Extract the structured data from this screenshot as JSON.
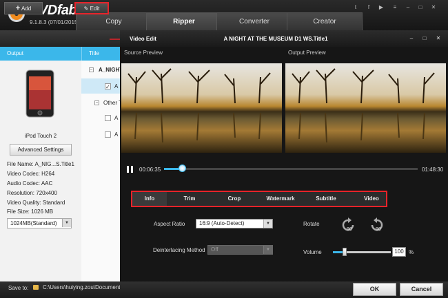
{
  "app": {
    "brand": "DVDfab",
    "version": "9.1.8.3 (07/01/2015)"
  },
  "tabs": [
    {
      "label": "Copy"
    },
    {
      "label": "Ripper"
    },
    {
      "label": "Converter"
    },
    {
      "label": "Creator"
    }
  ],
  "toolbar": {
    "add_label": "Add",
    "edit_label": "Edit"
  },
  "sidebar": {
    "header": "Output",
    "device_name": "iPod Touch 2",
    "advanced_label": "Advanced Settings",
    "info": [
      "File Name: A_NIG...S.Title1",
      "Video Codec: H264",
      "Audio Codec: AAC",
      "Resolution: 720x400",
      "Video Quality: Standard",
      "File Size: 1026 MB"
    ],
    "size_value": "1024MB(Standard)"
  },
  "titlelist": {
    "header": "Title",
    "group1": "A_NIGHT",
    "item1": "A",
    "group2": "Other T",
    "item2": "A",
    "item3": "A"
  },
  "editor": {
    "label": "Video Edit",
    "title": "A NIGHT AT THE MUSEUM D1 WS.Title1",
    "source_label": "Source Preview",
    "output_label": "Output Preview",
    "time_current": "00:06:35",
    "time_total": "01:48:30",
    "progress": 0.07,
    "tabs": [
      {
        "label": "Info"
      },
      {
        "label": "Trim"
      },
      {
        "label": "Crop"
      },
      {
        "label": "Watermark"
      },
      {
        "label": "Subtitle"
      },
      {
        "label": "Video"
      }
    ],
    "aspect_label": "Aspect Ratio",
    "aspect_value": "16:9 (Auto-Detect)",
    "deinterlace_label": "Deinterlacing Method",
    "deinterlace_value": "Off",
    "rotate_label": "Rotate",
    "rotate_left": "90",
    "rotate_right": "90",
    "volume_label": "Volume",
    "volume_value": "100",
    "volume_unit": "%",
    "volume_fraction": 0.2
  },
  "bottom": {
    "save_label": "Save to:",
    "save_path": "C:\\Users\\huiying.zou\\Document",
    "ok_label": "OK",
    "cancel_label": "Cancel"
  },
  "colors": {
    "accent": "#3bb7ea",
    "highlight": "#e8232a"
  }
}
